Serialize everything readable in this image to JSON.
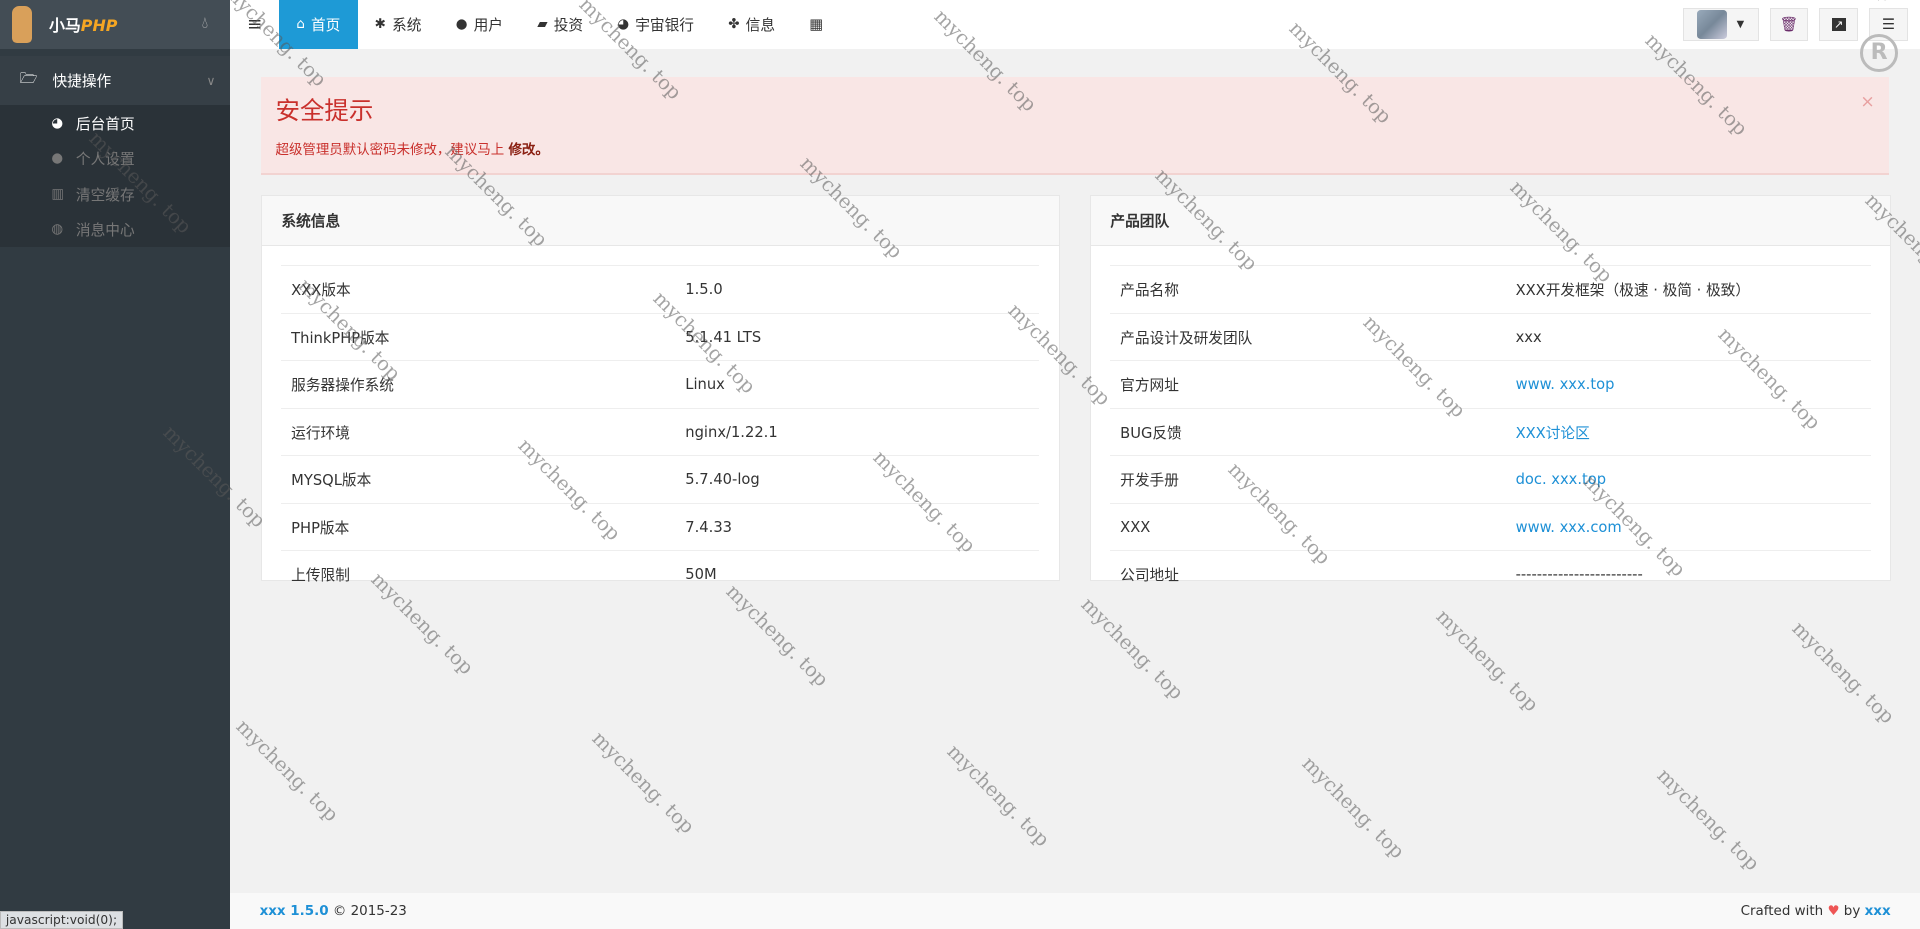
{
  "sidebar": {
    "brand_a": "小马",
    "brand_b": "PHP",
    "group": "快捷操作",
    "items": [
      {
        "label": "后台首页",
        "icon": "dashboard-icon",
        "glyph": "◕"
      },
      {
        "label": "个人设置",
        "icon": "user-icon",
        "glyph": "●"
      },
      {
        "label": "清空缓存",
        "icon": "trash-icon",
        "glyph": "▥"
      },
      {
        "label": "消息中心",
        "icon": "comments-icon",
        "glyph": "◍"
      }
    ]
  },
  "topbar": {
    "tabs": [
      {
        "label": "首页",
        "glyph": "⌂"
      },
      {
        "label": "系统",
        "glyph": "✱"
      },
      {
        "label": "用户",
        "glyph": "●"
      },
      {
        "label": "投资",
        "glyph": "▰"
      },
      {
        "label": "宇宙银行",
        "glyph": "◕"
      },
      {
        "label": "信息",
        "glyph": "✤"
      }
    ],
    "grid_glyph": "▦"
  },
  "alert": {
    "title": "安全提示",
    "message": "超级管理员默认密码未修改，建议马上 ",
    "link": "修改。",
    "close": "×"
  },
  "system": {
    "title": "系统信息",
    "rows": [
      [
        "XXX版本",
        "1.5.0"
      ],
      [
        "ThinkPHP版本",
        "5.1.41 LTS"
      ],
      [
        "服务器操作系统",
        "Linux"
      ],
      [
        "运行环境",
        "nginx/1.22.1"
      ],
      [
        "MYSQL版本",
        "5.7.40-log"
      ],
      [
        "PHP版本",
        "7.4.33"
      ],
      [
        "上传限制",
        "50M"
      ]
    ]
  },
  "team": {
    "title": "产品团队",
    "rows": [
      [
        "产品名称",
        "XXX开发框架（极速 · 极简 · 极致）"
      ],
      [
        "产品设计及研发团队",
        "xxx"
      ],
      [
        "官方网址",
        "www. xxx.top"
      ],
      [
        "BUG反馈",
        "XXX讨论区"
      ],
      [
        "开发手册",
        "doc. xxx.top"
      ],
      [
        "XXX",
        "www. xxx.com"
      ],
      [
        "公司地址",
        "------------------------"
      ]
    ]
  },
  "footer": {
    "version": "xxx 1.5.0",
    "copyright": " © 2015-23",
    "crafted": "Crafted with ",
    "by": " by ",
    "author": "xxx"
  },
  "status_bar": "javascript:void(0);",
  "watermark": "mycheng. top"
}
